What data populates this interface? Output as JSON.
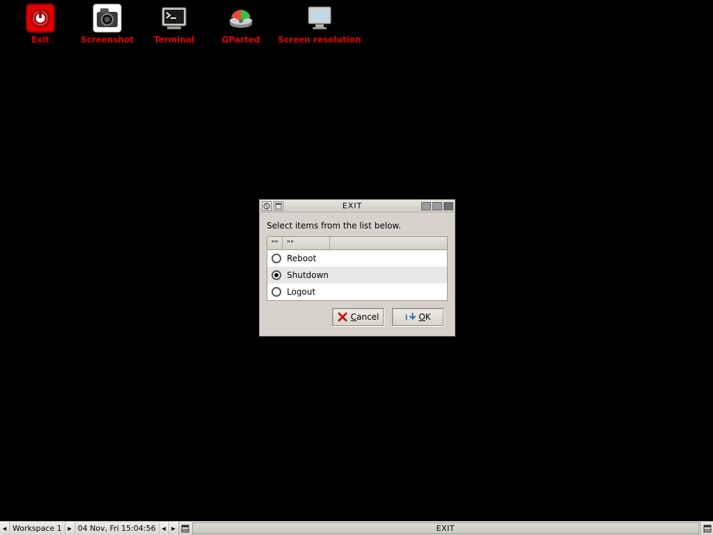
{
  "desktop": {
    "icons": [
      {
        "name": "exit",
        "label": "Exit"
      },
      {
        "name": "screenshot",
        "label": "Screenshot"
      },
      {
        "name": "terminal",
        "label": "Terminal"
      },
      {
        "name": "gparted",
        "label": "GParted"
      },
      {
        "name": "screenres",
        "label": "Screen resolution"
      }
    ]
  },
  "dialog": {
    "title": "EXIT",
    "instruction": "Select items from the list below.",
    "columns": {
      "c1": "\"\"",
      "c2": "\"\"",
      "c3": ""
    },
    "options": [
      {
        "id": "reboot",
        "label": "Reboot",
        "selected": false
      },
      {
        "id": "shutdown",
        "label": "Shutdown",
        "selected": true
      },
      {
        "id": "logout",
        "label": "Logout",
        "selected": false
      }
    ],
    "buttons": {
      "cancel": "Cancel",
      "ok": "OK"
    }
  },
  "taskbar": {
    "workspace": "Workspace 1",
    "clock": "04 Nov, Fri 15:04:56",
    "task_title": "EXIT"
  }
}
